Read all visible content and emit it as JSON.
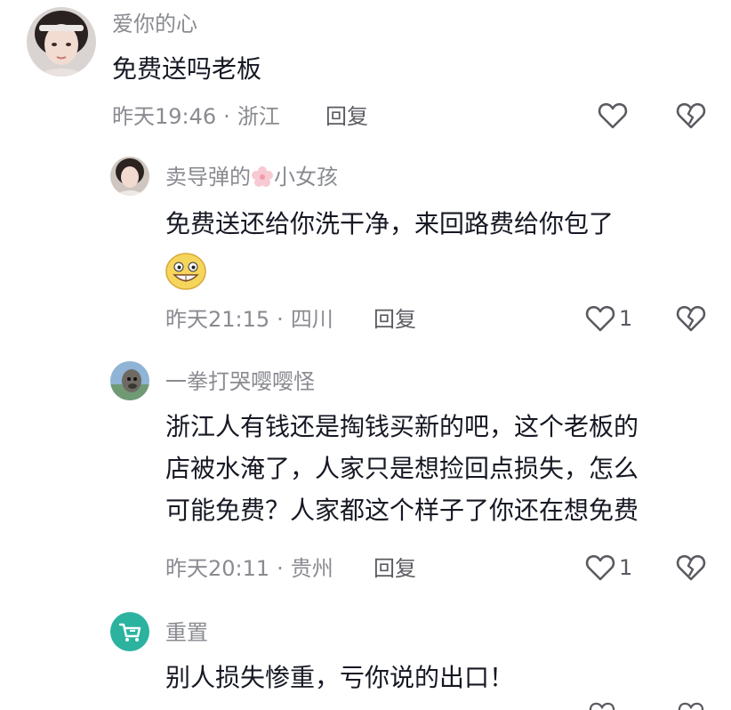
{
  "comments": [
    {
      "username": "爱你的心",
      "text": "免费送吗老板",
      "time": "昨天19:46",
      "location": "浙江",
      "reply_label": "回复",
      "likes": ""
    },
    {
      "username_part1": "卖导弹的",
      "username_part2": "小女孩",
      "text": "免费送还给你洗干净，来回路费给你包了",
      "time": "昨天21:15",
      "location": "四川",
      "reply_label": "回复",
      "likes": "1"
    },
    {
      "username": "一拳打哭嘤嘤怪",
      "text_lines": [
        "浙江人有钱还是掏钱买新的吧，这个老板的",
        "店被水淹了，人家只是想捡回点损失，怎么",
        "可能免费？人家都这个样子了你还在想免费"
      ],
      "time": "昨天20:11",
      "location": "贵州",
      "reply_label": "回复",
      "likes": "1"
    },
    {
      "username": "重置",
      "text": "别人损失惨重，亏你说的出口！"
    }
  ],
  "separator": "·",
  "icons": {
    "like": "heart-outline-icon",
    "dislike": "broken-heart-icon",
    "emoji": "grin-emoji-icon",
    "flower": "cherry-blossom-icon"
  },
  "colors": {
    "text": "#161823",
    "secondary": "#8a8b91",
    "reply": "#5a5b61",
    "avatar4_bg": "#2bb3a0"
  }
}
